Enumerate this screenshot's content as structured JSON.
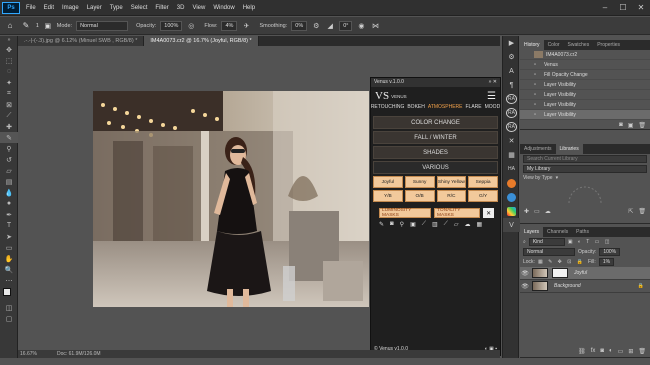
{
  "menu": {
    "logo": "Ps",
    "items": [
      "File",
      "Edit",
      "Image",
      "Layer",
      "Type",
      "Select",
      "Filter",
      "3D",
      "View",
      "Window",
      "Help"
    ]
  },
  "options": {
    "brush_size": "1",
    "mode_label": "Mode:",
    "mode_value": "Normal",
    "opacity_label": "Opacity:",
    "opacity_value": "100%",
    "flow_label": "Flow:",
    "flow_value": "4%",
    "smoothing_label": "Smoothing:",
    "smoothing_value": "0%",
    "extra_value": "0°"
  },
  "tabs": [
    {
      "label": ".-.-|-(-.3).jpg @ 6.12% (Minuel SWB , RGB/8) *",
      "active": false
    },
    {
      "label": "IM4A0073.cr2 @ 16.7% (Joyful, RGB/8) *",
      "active": true
    }
  ],
  "status": {
    "zoom": "16.67%",
    "doc": "Doc: 61.9M/126.0M"
  },
  "plugin": {
    "title": "Venus v.1.0.0",
    "logo_text": "VENUS",
    "nav": [
      "RETOUCHING",
      "BOKEH",
      "ATMOSPHERE",
      "FLARE",
      "MOOD"
    ],
    "active_nav": "ATMOSPHERE",
    "buttons": [
      "COLOR CHANGE",
      "FALL / WINTER",
      "SHADES",
      "VARIOUS"
    ],
    "grid": [
      "Joyful",
      "Sunny",
      "Shiny Yellow",
      "Seppia",
      "Y/B",
      "O/B",
      "R/C",
      "G/Y"
    ],
    "masks": [
      "LUMINOSITY MASKS",
      "TONALITY MASKS"
    ],
    "close_label": "✕",
    "footer": "© Venus v1.0.0"
  },
  "history": {
    "tabs": [
      "History",
      "Color",
      "Swatches",
      "Properties"
    ],
    "snapshot": "IM4A0073.cr2",
    "items": [
      "Venus",
      "Fill Opacity Change",
      "Layer Visibility",
      "Layer Visibility",
      "Layer Visibility",
      "Layer Visibility"
    ]
  },
  "adjust": {
    "tabs": [
      "Adjustments",
      "Libraries"
    ],
    "search_placeholder": "Search Current Library",
    "library": "My Library",
    "view_by": "View by Type"
  },
  "layers": {
    "tabs": [
      "Layers",
      "Channels",
      "Paths"
    ],
    "kind": "Kind",
    "blend": "Normal",
    "opacity_label": "Opacity:",
    "opacity": "100%",
    "lock_label": "Lock:",
    "fill_label": "Fill:",
    "fill": "1%",
    "items": [
      {
        "name": "Joyful",
        "selected": true
      },
      {
        "name": "Background",
        "selected": false
      }
    ]
  },
  "colors": {
    "accent": "#f0a04a",
    "tile": "#f2c99b",
    "ps_blue": "#31a8ff"
  }
}
